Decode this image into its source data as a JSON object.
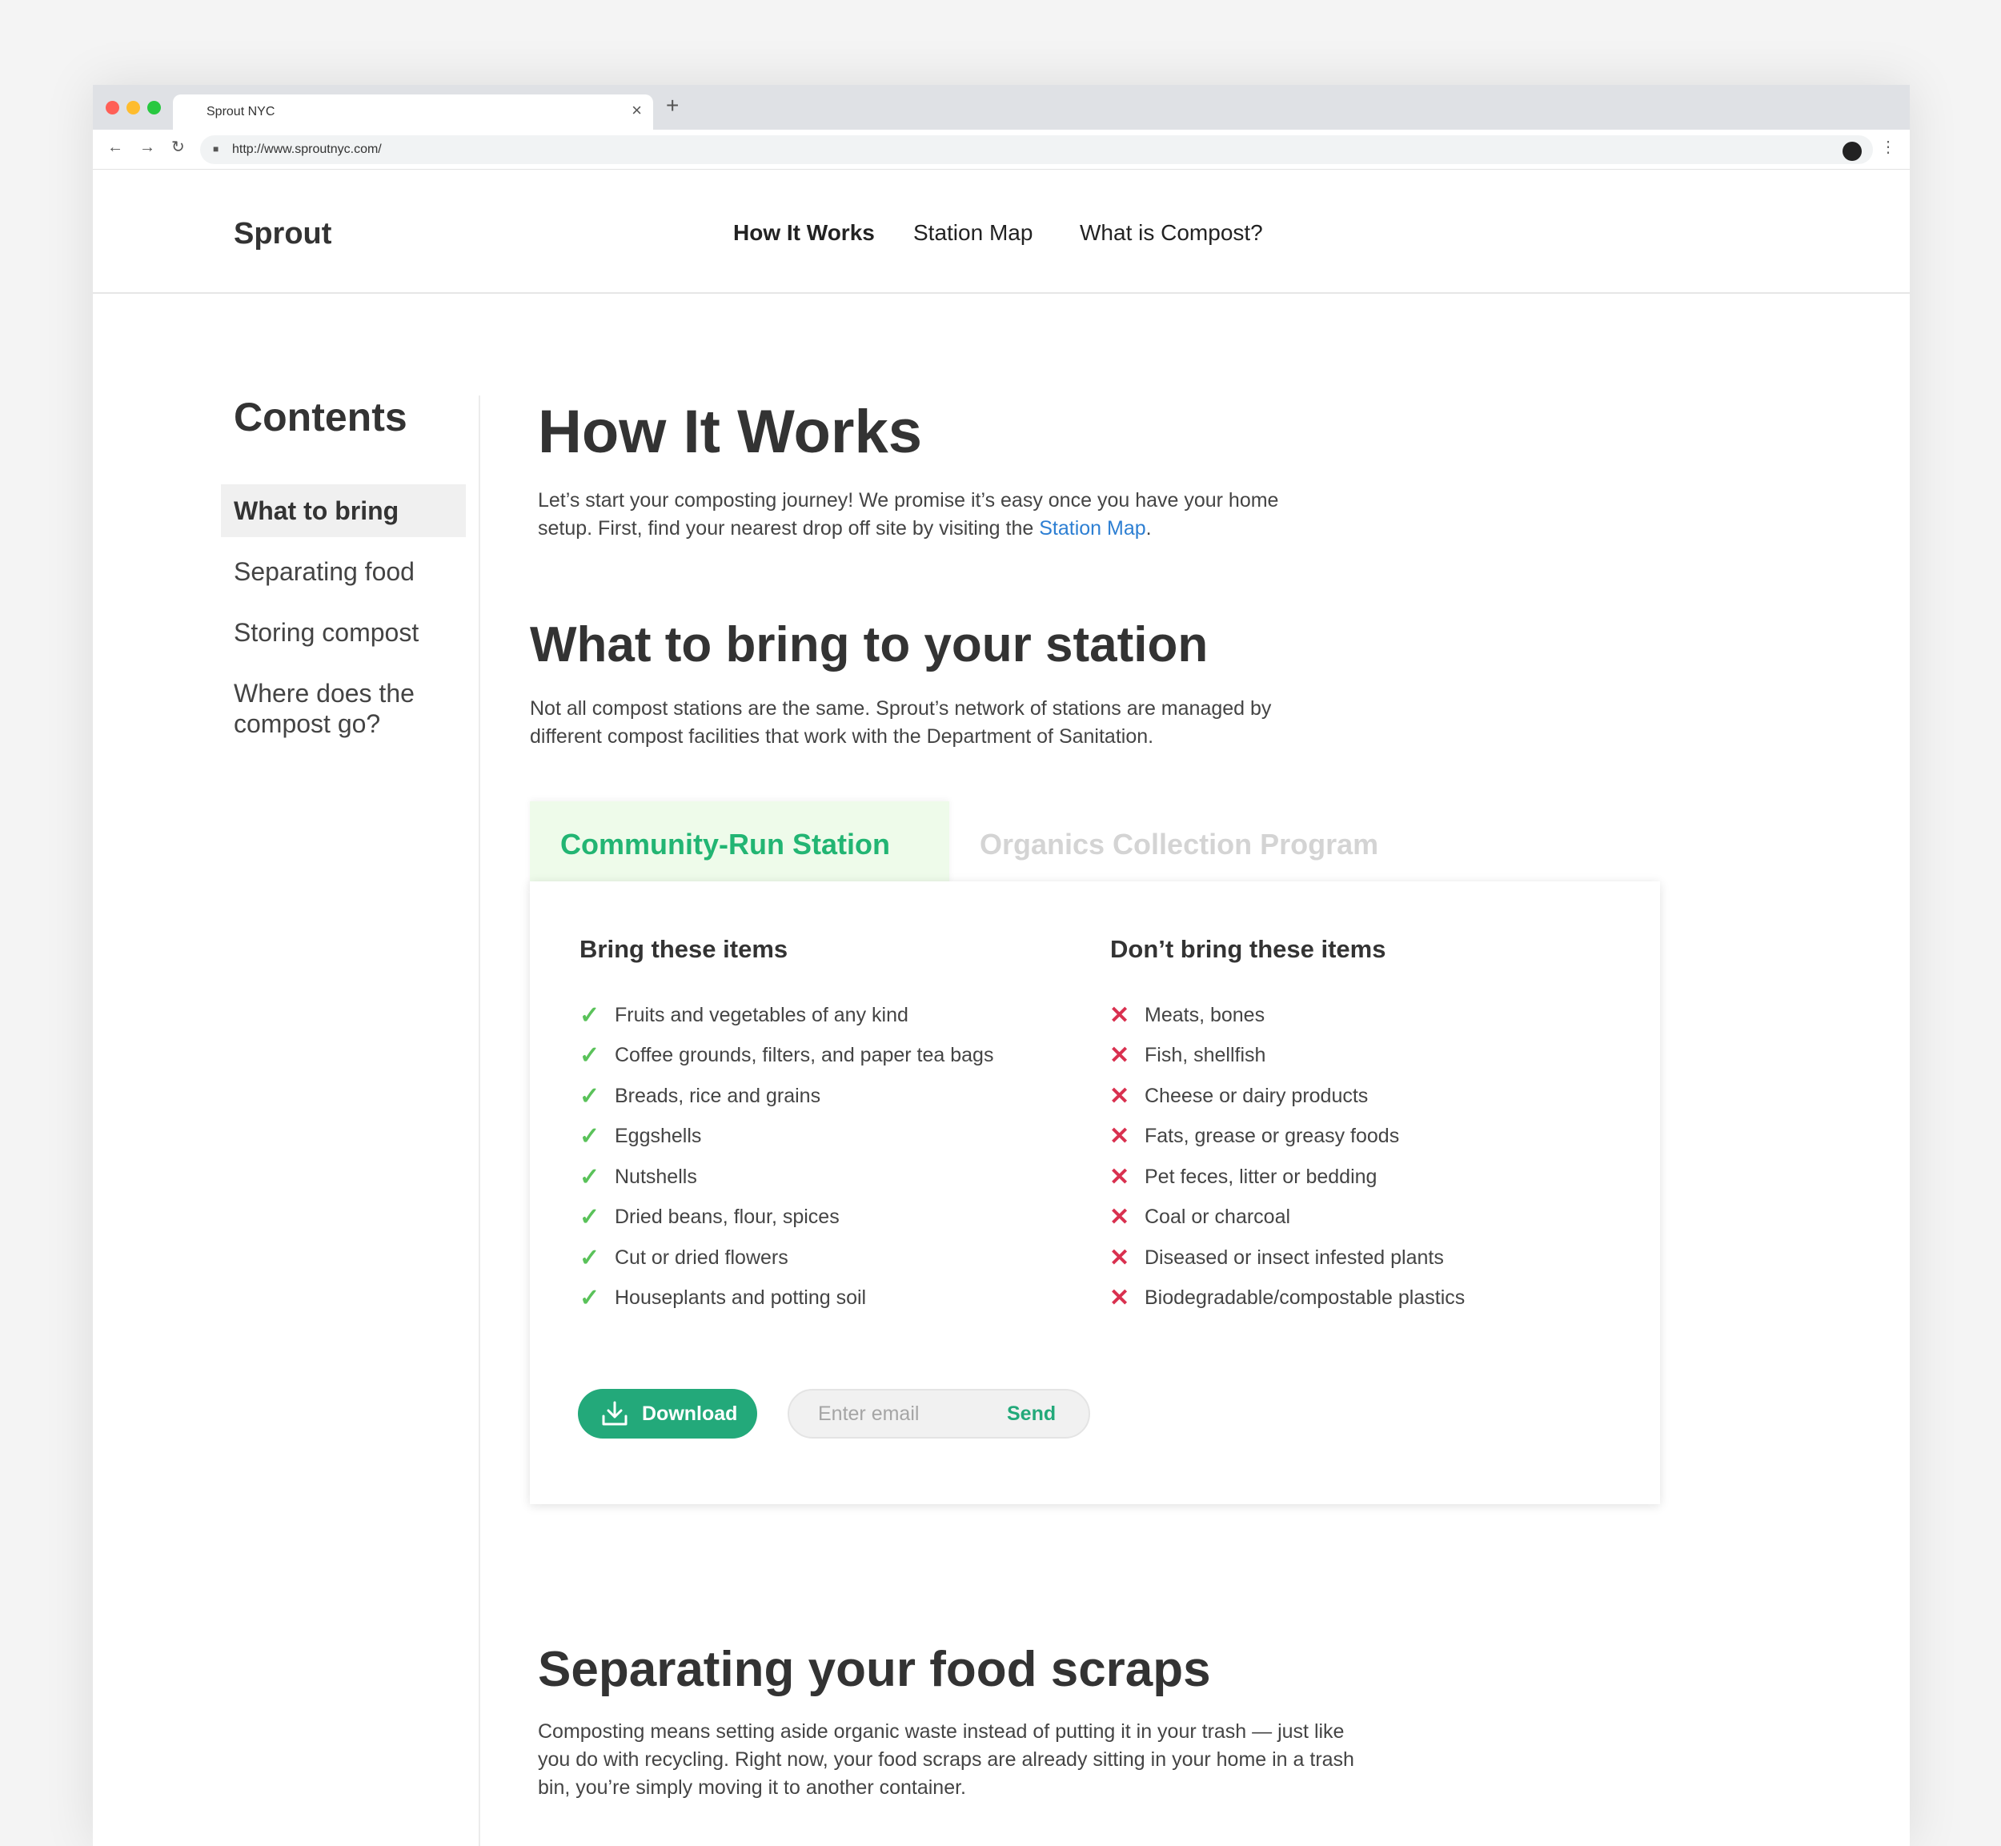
{
  "browser": {
    "tab_title": "Sprout NYC",
    "tab_close": "×",
    "new_tab": "+",
    "url": "http://www.sproutnyc.com/"
  },
  "site": {
    "logo": "Sprout",
    "nav": [
      "How It Works",
      "Station Map",
      "What is Compost?"
    ]
  },
  "sidebar": {
    "title": "Contents",
    "items": [
      "What to bring",
      "Separating food",
      "Storing compost",
      "Where does the compost go?"
    ]
  },
  "main": {
    "title": "How It Works",
    "intro_text": "Let’s start your composting journey! We promise it’s easy once you have your home setup. First, find your nearest drop off site by visiting the ",
    "intro_link": "Station Map",
    "intro_end": ".",
    "section1_title": "What to bring to your station",
    "section1_text": "Not all compost stations are the same. Sprout’s network of stations are managed by different compost facilities that work with the Department of Sanitation.",
    "tabs": [
      "Community-Run Station",
      "Organics Collection Program"
    ],
    "bring_title": "Bring these items",
    "bring_items": [
      "Fruits and vegetables of any kind",
      "Coffee grounds, filters, and paper tea bags",
      "Breads, rice and grains",
      "Eggshells",
      "Nutshells",
      "Dried beans, flour, spices",
      "Cut or dried flowers",
      "Houseplants and potting soil"
    ],
    "dont_title": "Don’t bring these items",
    "dont_items": [
      "Meats, bones",
      "Fish, shellfish",
      "Cheese or dairy products",
      "Fats, grease or greasy foods",
      "Pet feces, litter or bedding",
      "Coal or charcoal",
      "Diseased or insect infested plants",
      "Biodegradable/compostable plastics"
    ],
    "download_label": "Download",
    "email_placeholder": "Enter email",
    "send_label": "Send",
    "section2_title": "Separating your food scraps",
    "section2_text": "Composting means setting aside organic waste instead of putting it in your trash — just like you do with recycling. Right now, your food scraps are already sitting in your home in a trash bin, you’re simply moving it to another container."
  },
  "colors": {
    "accent_green": "#22b573",
    "button_green": "#23a97a",
    "check_green": "#5ac25a",
    "cross_red": "#d9304f",
    "link_blue": "#2d7fd3"
  }
}
